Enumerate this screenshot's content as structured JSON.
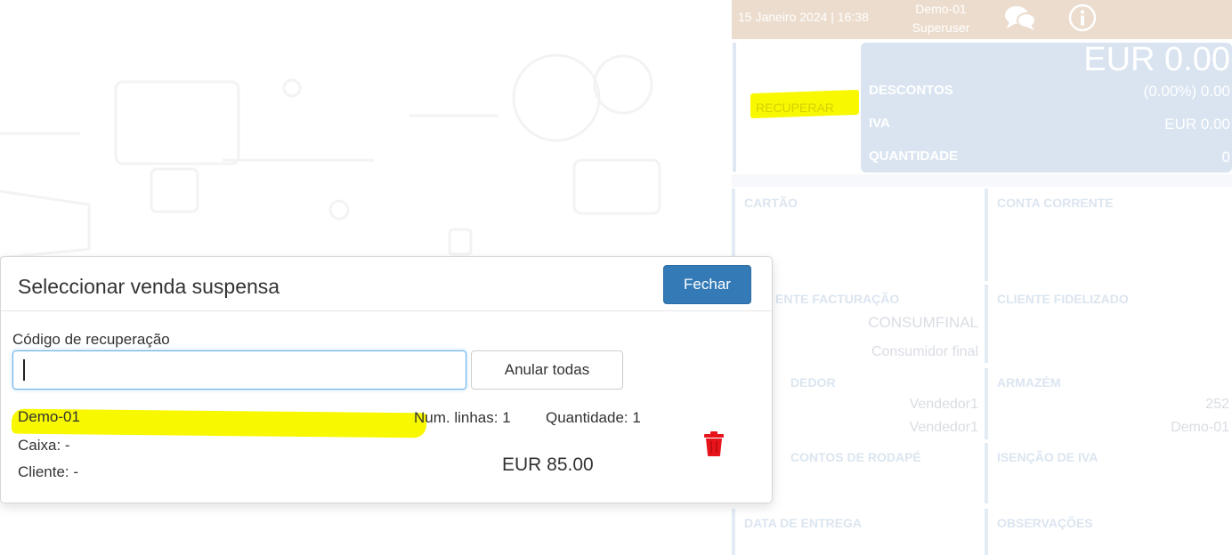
{
  "header": {
    "datetime": "15 Janeiro 2024 | 16:38",
    "store": "Demo-01",
    "user_role": "Superuser",
    "icons": [
      "chat-icon",
      "info-icon"
    ]
  },
  "summary": {
    "recover_label": "RECUPERAR",
    "total": "EUR 0.00",
    "rows": [
      {
        "label": "DESCONTOS",
        "value": "(0.00%) 0.00"
      },
      {
        "label": "IVA",
        "value": "EUR 0.00"
      },
      {
        "label": "QUANTIDADE",
        "value": "0"
      }
    ]
  },
  "tiles": {
    "cartao": {
      "title": "CARTÃO"
    },
    "conta_corrente": {
      "title": "CONTA CORRENTE"
    },
    "cliente_facturacao": {
      "title": "CLIENTE FACTURAÇÃO",
      "visible_title": "ENTE FACTURAÇÃO",
      "value1": "CONSUMFINAL",
      "value2": "Consumidor final"
    },
    "cliente_fidelizado": {
      "title": "CLIENTE FIDELIZADO"
    },
    "vendedor": {
      "visible_title": "DEDOR",
      "value1": "Vendedor1",
      "value2": "Vendedor1"
    },
    "armazem": {
      "title": "ARMAZÉM",
      "value1": "252",
      "value2": "Demo-01"
    },
    "descontos_rodape": {
      "visible_title": "CONTOS DE RODAPÉ"
    },
    "isencao_iva": {
      "title": "ISENÇÃO DE IVA"
    },
    "data_entrega": {
      "title": "DATA DE ENTREGA"
    },
    "observacoes": {
      "title": "OBSERVAÇÕES"
    }
  },
  "modal": {
    "title": "Seleccionar venda suspensa",
    "close_label": "Fechar",
    "code_label": "Código de recuperação",
    "code_value": "",
    "void_all_label": "Anular todas",
    "sales": [
      {
        "name": "Demo-01",
        "caixa": "Caixa: -",
        "cliente": "Cliente: -",
        "lines": "Num. linhas: 1",
        "quantity": "Quantidade: 1",
        "amount": "EUR 85.00",
        "action_icon": "trash-icon"
      }
    ]
  },
  "colors": {
    "header_bg": "#ecdccd",
    "totals_bg": "#d9e4f0",
    "primary_button": "#337ab7",
    "highlight": "#f8f800",
    "delete": "#e8141b"
  }
}
